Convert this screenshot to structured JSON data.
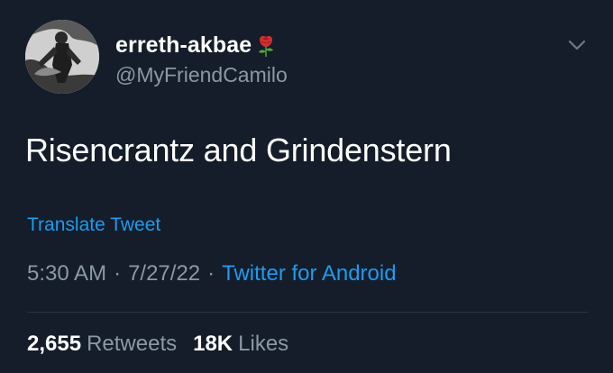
{
  "colors": {
    "background": "#141d29",
    "text_primary": "#ffffff",
    "text_secondary": "#8b98a5",
    "link": "#1d9bf0",
    "divider": "#2f3336"
  },
  "author": {
    "display_name": "erreth-akbae",
    "name_emoji": "rose-emoji-icon",
    "handle": "@MyFriendCamilo",
    "avatar": "avatar-image"
  },
  "tweet": {
    "text": "Risencrantz and Grindenstern",
    "translate_label": "Translate Tweet",
    "time": "5:30 AM",
    "date": "7/27/22",
    "separator": "·",
    "source": "Twitter for Android"
  },
  "stats": {
    "retweets_count": "2,655",
    "retweets_label": "Retweets",
    "likes_count": "18K",
    "likes_label": "Likes"
  },
  "menu": {
    "icon": "chevron-down-icon"
  }
}
